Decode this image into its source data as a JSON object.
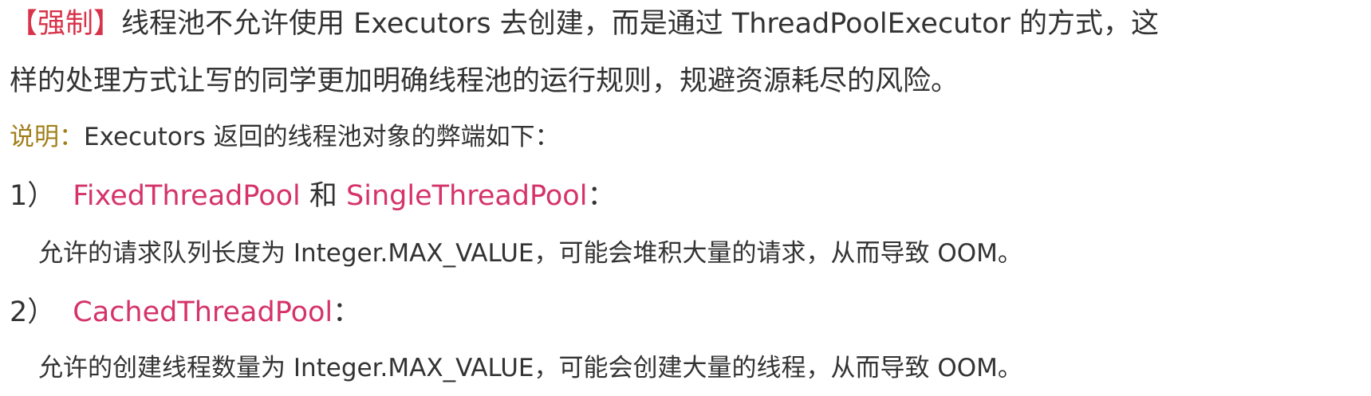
{
  "rule": {
    "tag": "【强制】",
    "text_line1": "线程池不允许使用 Executors 去创建，而是通过 ThreadPoolExecutor 的方式，这",
    "text_line2": "样的处理方式让写的同学更加明确线程池的运行规则，规避资源耗尽的风险。"
  },
  "explanation": {
    "label": "说明：",
    "text": "Executors 返回的线程池对象的弊端如下："
  },
  "items": [
    {
      "number": "1）",
      "name_a": "FixedThreadPool",
      "conj": " 和 ",
      "name_b": "SingleThreadPool",
      "colon": "：",
      "detail": "允许的请求队列长度为 Integer.MAX_VALUE，可能会堆积大量的请求，从而导致 OOM。"
    },
    {
      "number": "2）",
      "name_a": "CachedThreadPool",
      "colon": "：",
      "detail": "允许的创建线程数量为 Integer.MAX_VALUE，可能会创建大量的线程，从而导致 OOM。"
    }
  ],
  "colors": {
    "tag": "#d8334a",
    "pool_name": "#d5336a",
    "label": "#a07f1a",
    "text": "#333333"
  }
}
